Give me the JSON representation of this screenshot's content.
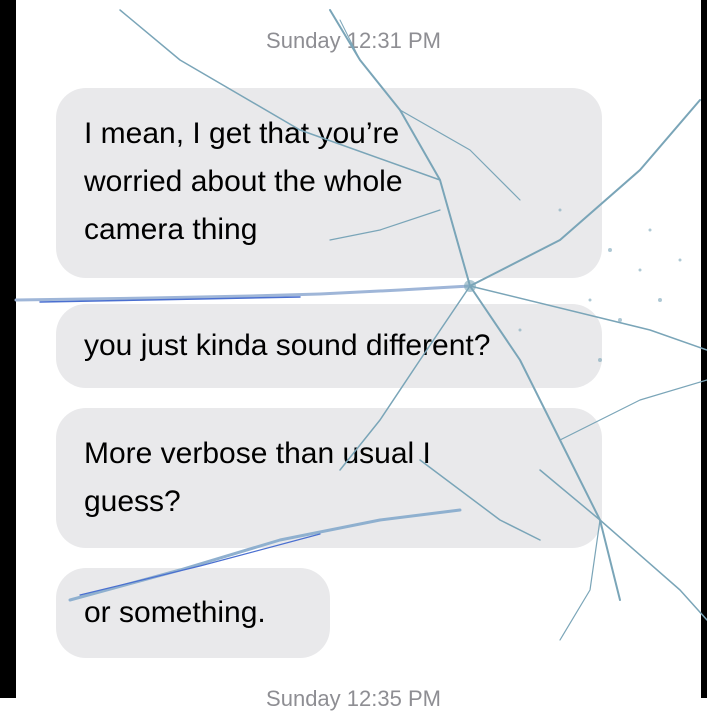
{
  "conversation": {
    "timestamp_top": "Sunday 12:31 PM",
    "timestamp_bottom": "Sunday 12:35 PM",
    "messages": [
      {
        "lines": [
          "I mean, I get that you’re",
          "worried about the whole",
          "camera thing"
        ]
      },
      {
        "lines": [
          "you just kinda sound different?"
        ]
      },
      {
        "lines": [
          "More verbose than usual I",
          "guess?"
        ]
      },
      {
        "lines": [
          "or something."
        ]
      }
    ]
  },
  "overlay": {
    "name": "cracked-glass-overlay",
    "color": "#7aa5b8"
  }
}
